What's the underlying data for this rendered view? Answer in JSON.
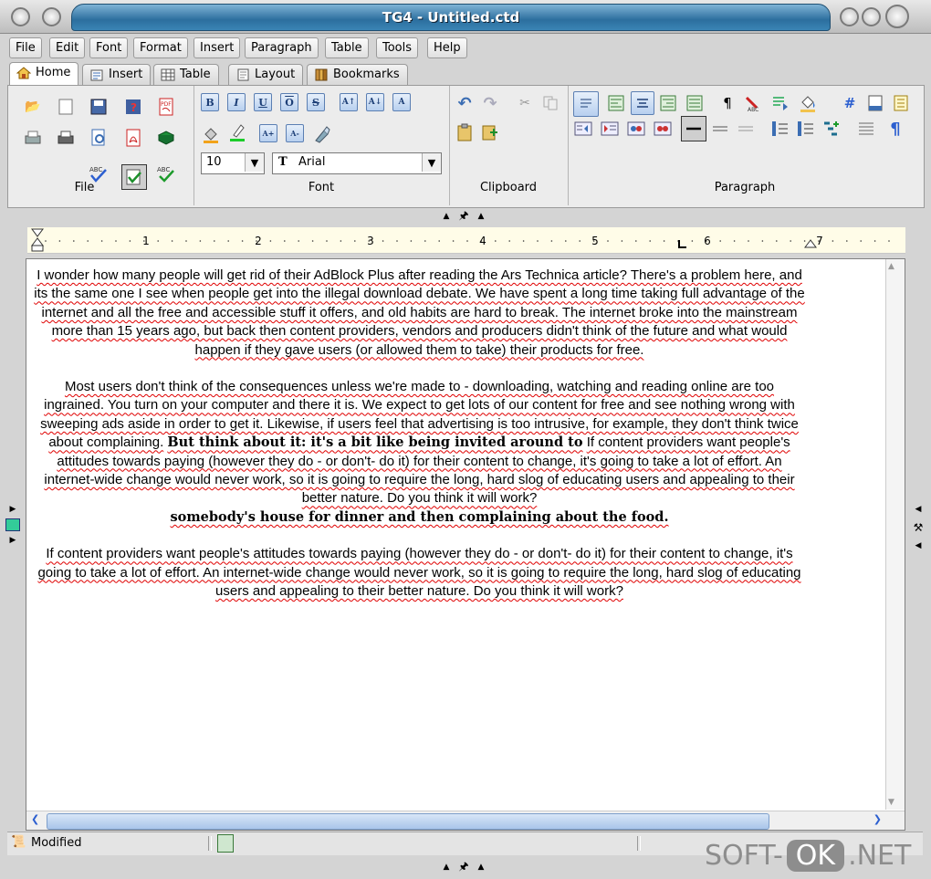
{
  "window": {
    "title": "TG4 - Untitled.ctd"
  },
  "menu": [
    "File",
    "Edit",
    "Font",
    "Format",
    "Insert",
    "Paragraph",
    "Table",
    "Tools",
    "Help"
  ],
  "tabs": [
    {
      "label": "Home",
      "icon": "home-icon"
    },
    {
      "label": "Insert",
      "icon": "insert-icon"
    },
    {
      "label": "Table",
      "icon": "table-icon"
    },
    {
      "label": "Layout",
      "icon": "layout-icon"
    },
    {
      "label": "Bookmarks",
      "icon": "bookmarks-icon"
    }
  ],
  "ribbon": {
    "groups": {
      "file": "File",
      "font": "Font",
      "clipboard": "Clipboard",
      "paragraph": "Paragraph"
    },
    "font_size": "10",
    "font_name": "Arial"
  },
  "ruler": {
    "ticks": [
      "1",
      "2",
      "3",
      "4",
      "5",
      "6",
      "7"
    ]
  },
  "document": {
    "p1": "I wonder how many people will get rid of their AdBlock Plus after reading the Ars Technica article? There's a problem here, and its the same one I see when people get into the illegal download debate. We have spent a long time taking full advantage of the internet and all the free and accessible stuff it offers, and old habits are hard to break. The internet broke into the mainstream more than 15 years ago,  but back then content providers, vendors and producers didn't think of the future and what would happen if they gave users (or allowed them to take) their products for free.",
    "p2_a": "Most users don't think of the consequences unless we're made to - downloading, watching and reading online are too ingrained. You turn on your computer and there it is. We expect to get lots of our content for free and see nothing wrong with sweeping ads aside in order to get it. Likewise, if users feel that advertising is too intrusive, for example, they don't think twice about complaining.",
    "p2_bold1": "But think about it:  it's a bit like being invited around to",
    "p2_b": "If content providers want people's attitudes towards paying (however they do - or don't- do it) for their content to change, it's going to take a lot of effort. An internet-wide change would never work, so it is going to require the long, hard slog of educating users and appealing to their better nature. Do you think it will work?",
    "p2_bold2": "somebody's house for dinner and then complaining about the food.",
    "p3": "If content providers want people's attitudes towards paying (however they do - or don't- do it) for their content to change, it's going to take a lot of effort. An internet-wide change would never work, so it is going to require the long, hard slog of educating users and appealing to their better nature. Do you think it will work?"
  },
  "status": {
    "text": "Modified"
  },
  "watermark": {
    "left": "SOFT-",
    "mid": "OK",
    "right": ".NET"
  },
  "colors": {
    "accent": "#2c6f9e",
    "spell": "#e00000"
  }
}
